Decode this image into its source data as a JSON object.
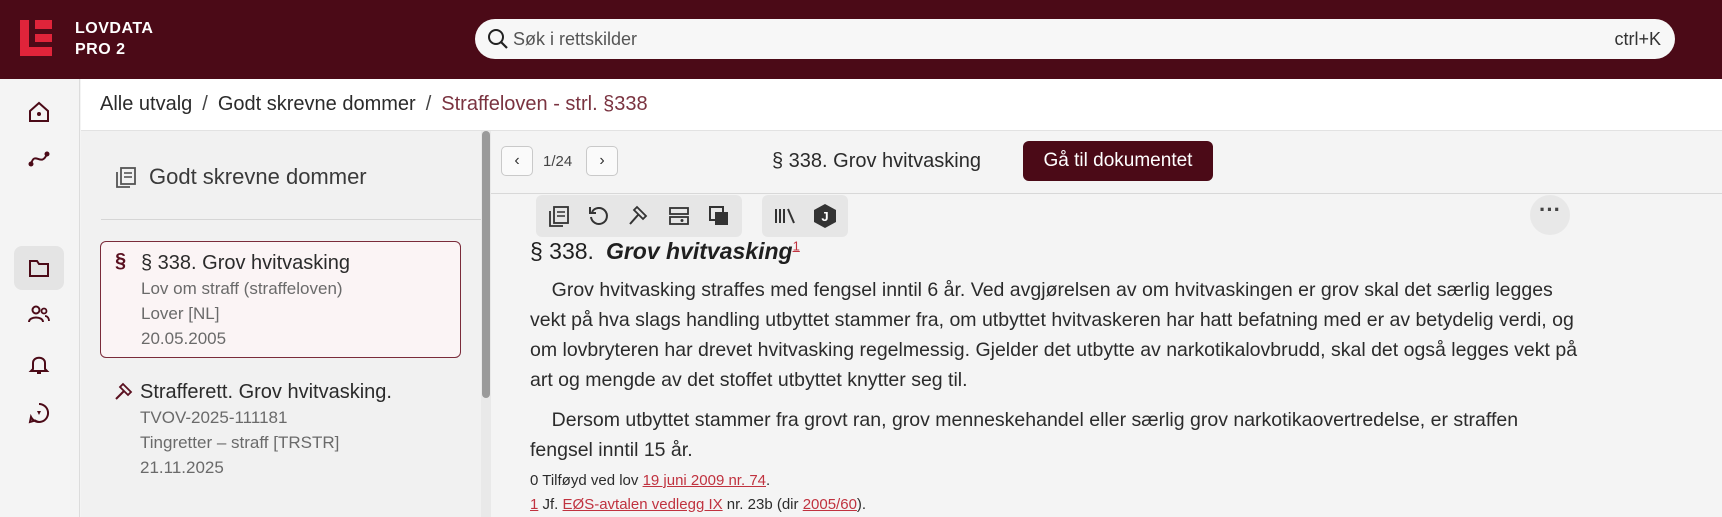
{
  "app": {
    "brand_line1": "LOVDATA",
    "brand_line2": "PRO 2",
    "brand_color": "#4b0a17"
  },
  "search": {
    "placeholder": "Søk i rettskilder",
    "shortcut": "ctrl+K"
  },
  "rail": {
    "items": [
      "home-icon",
      "graph-icon",
      "folder-icon",
      "users-icon",
      "bell-icon",
      "feedback-icon"
    ],
    "active": "folder-icon"
  },
  "breadcrumb": {
    "items": [
      "Alle utvalg",
      "Godt skrevne dommer",
      "Straffeloven - strl. §338"
    ],
    "separator": "/"
  },
  "list": {
    "title": "Godt skrevne dommer",
    "items": [
      {
        "glyph": "§",
        "title": "§ 338. Grov hvitvasking",
        "line1": "Lov om straff (straffeloven)",
        "line2": "Lover [NL]",
        "line3": "20.05.2005"
      },
      {
        "glyph": "gavel-icon",
        "title": "Strafferett. Grov hvitvasking.",
        "line1": "TVOV-2025-111181",
        "line2": "Tingretter – straff [TRSTR]",
        "line3": "21.11.2025"
      }
    ]
  },
  "doc": {
    "pager": "1/24",
    "prev": "‹",
    "next": "›",
    "title": "§ 338. Grov hvitvasking",
    "goto_label": "Gå til dokumentet",
    "more": "···",
    "section_number": "§ 338.",
    "section_name": "Grov hvitvasking",
    "section_footnote": "1",
    "paragraph1": "Grov hvitvasking straffes med fengsel inntil 6 år. Ved avgjørelsen av om hvitvaskingen er grov skal det særlig legges vekt på hva slags handling utbyttet stammer fra, om utbyttet hvitvaskeren har hatt befatning med er av betydelig verdi, og om lovbryteren har drevet hvitvasking regelmessig. Gjelder det utbytte av narkotikalovbrudd, skal det også legges vekt på art og mengde av det stoffet utbyttet knytter seg til.",
    "paragraph2": "Dersom utbyttet stammer fra grovt ran, grov menneskehandel eller særlig grov narkotikaovertredelse, er straffen fengsel inntil 15 år.",
    "footnote0_prefix": "0 Tilføyd ved lov",
    "footnote0_link": "19 juni 2009 nr. 74",
    "footnote0_suffix": ".",
    "footnote1_num": "1",
    "footnote1_prefix": "Jf.",
    "footnote1_link": "EØS-avtalen vedlegg IX",
    "footnote1_mid": "nr. 23b (dir",
    "footnote1_link2": "2005/60",
    "footnote1_suffix": ")."
  }
}
